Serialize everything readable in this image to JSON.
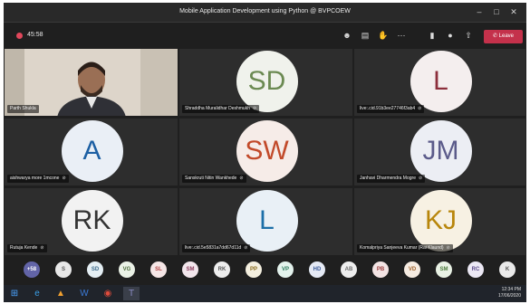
{
  "window": {
    "title": "Mobile Application Development using Python @ BVPCOEW"
  },
  "toolbar": {
    "timer": "45:58",
    "leave_label": "Leave"
  },
  "tiles": [
    {
      "name": "Parth Shukla",
      "type": "video"
    },
    {
      "name": "Shraddha Muralidhar Deshmukh",
      "initials": "SD",
      "color": "#6b8a52",
      "bg": "#f0f2ec"
    },
    {
      "name": "live:.cid.91b3ee27746f3ab4",
      "initials": "L",
      "color": "#8c2f3c",
      "bg": "#f4eeee"
    },
    {
      "name": "aishwarya more 1mcone",
      "initials": "A",
      "color": "#1c5fa3",
      "bg": "#eaeff6"
    },
    {
      "name": "Sanskruti Nitin Wankhede",
      "initials": "SW",
      "color": "#c24a2a",
      "bg": "#f6ece8"
    },
    {
      "name": "Janhavi Dharmendra Mogre",
      "initials": "JM",
      "color": "#5b5b8a",
      "bg": "#eceef4"
    },
    {
      "name": "Rutuja Kende",
      "initials": "RK",
      "color": "#333333",
      "bg": "#f2f2f2"
    },
    {
      "name": "live:.cid.5e5831a7dd67d11d",
      "initials": "L",
      "color": "#1c6fa8",
      "bg": "#e9f0f6"
    },
    {
      "name": "Komalpriya Sanjeeva Kumar (Rai Klaund)",
      "initials": "KJ",
      "color": "#b8860b",
      "bg": "#f7f1e3"
    }
  ],
  "strip": [
    {
      "label": "+58",
      "fg": "#ffffff",
      "bg": "#6264a7"
    },
    {
      "label": "S",
      "fg": "#555555",
      "bg": "#e8e8e8"
    },
    {
      "label": "SD",
      "fg": "#3b6a8a",
      "bg": "#e4eef3"
    },
    {
      "label": "VG",
      "fg": "#4b6b3b",
      "bg": "#eaf1e6"
    },
    {
      "label": "SL",
      "fg": "#b04040",
      "bg": "#f5e6e6"
    },
    {
      "label": "SM",
      "fg": "#8a3b5b",
      "bg": "#f2e6ec"
    },
    {
      "label": "RK",
      "fg": "#555555",
      "bg": "#ececec"
    },
    {
      "label": "PP",
      "fg": "#8a6b1b",
      "bg": "#f4efdf"
    },
    {
      "label": "VP",
      "fg": "#2b7a5b",
      "bg": "#e3f2ec"
    },
    {
      "label": "HD",
      "fg": "#3b5b9a",
      "bg": "#e5eaf5"
    },
    {
      "label": "AB",
      "fg": "#6b6b6b",
      "bg": "#eeeeee"
    },
    {
      "label": "PB",
      "fg": "#9a3b3b",
      "bg": "#f3e4e4"
    },
    {
      "label": "VD",
      "fg": "#a0622a",
      "bg": "#f5ebe1"
    },
    {
      "label": "SM",
      "fg": "#4b7a3b",
      "bg": "#e8f1e4"
    },
    {
      "label": "RC",
      "fg": "#5b4b8a",
      "bg": "#ebe8f4"
    },
    {
      "label": "K",
      "fg": "#555555",
      "bg": "#e9e9e9"
    }
  ],
  "taskbar": {
    "time": "12:34 PM",
    "date": "17/06/2020"
  },
  "icons": [
    "minimize-icon",
    "maximize-icon",
    "close-icon",
    "participants-icon",
    "chat-icon",
    "raise-hand-icon",
    "more-icon",
    "camera-icon",
    "mic-icon",
    "share-icon",
    "phone-icon"
  ]
}
